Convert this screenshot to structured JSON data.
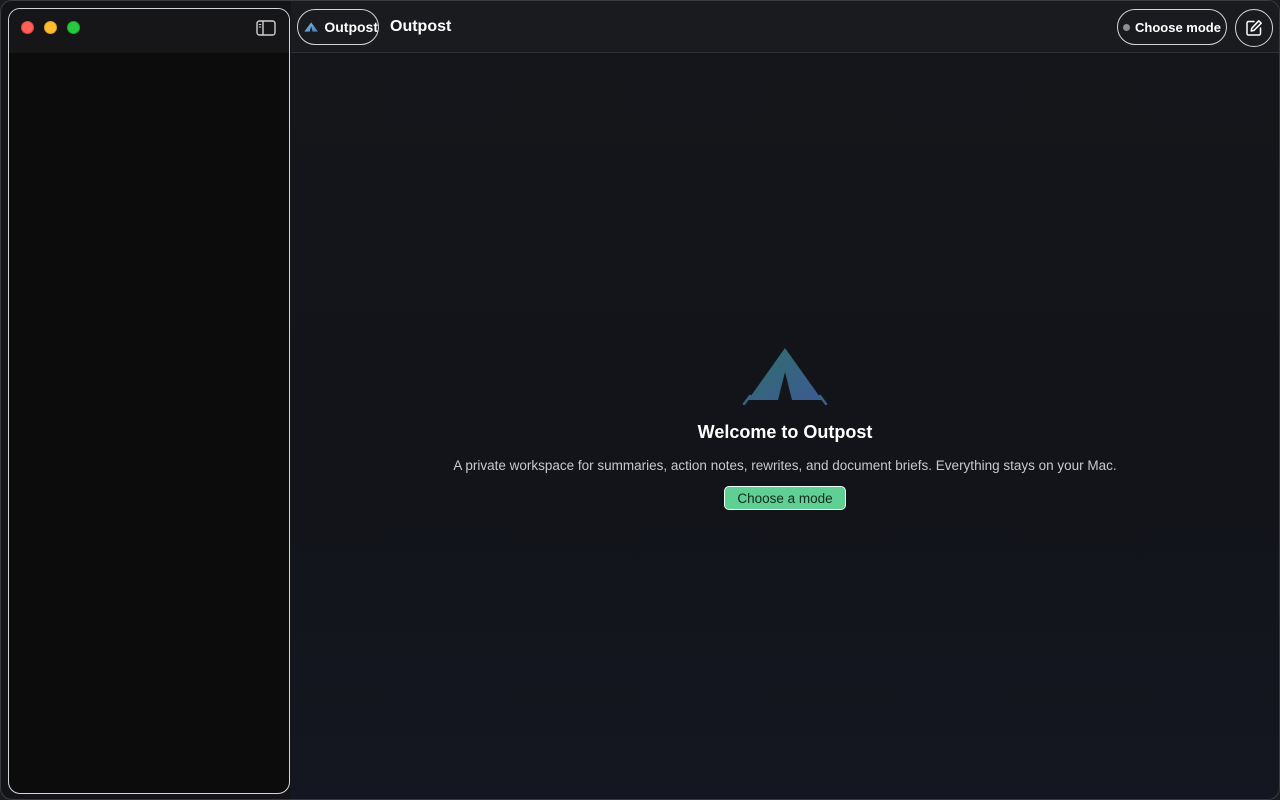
{
  "window": {
    "traffic_lights": [
      "close",
      "minimize",
      "maximize"
    ]
  },
  "sidebar": {
    "toggle_icon": "sidebar-toggle-icon"
  },
  "toolbar": {
    "app_chip_label": "Outpost",
    "title": "Outpost",
    "mode_button_label": "Choose mode",
    "compose_icon": "compose-icon"
  },
  "welcome": {
    "title": "Welcome to Outpost",
    "subtitle": "A private workspace for summaries, action notes, rewrites, and document briefs. Everything stays on your Mac.",
    "cta_label": "Choose a mode"
  },
  "colors": {
    "accent": "#5fcf93",
    "logo_teal": "#2f6f6c",
    "logo_blue": "#3c5a92"
  }
}
